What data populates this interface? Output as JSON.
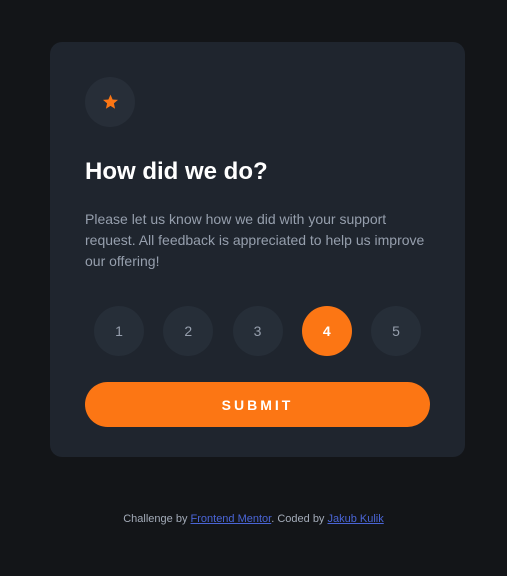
{
  "card": {
    "icon": "star-icon",
    "title": "How did we do?",
    "description": "Please let us know how we did with your support request. All feedback is appreciated to help us improve our offering!",
    "ratings": [
      "1",
      "2",
      "3",
      "4",
      "5"
    ],
    "selected_rating": "4",
    "submit_label": "SUBMIT"
  },
  "footer": {
    "prefix": "Challenge by ",
    "link1": "Frontend Mentor",
    "middle": ". Coded by ",
    "link2": "Jakub Kulik"
  },
  "colors": {
    "accent": "#fc7614",
    "card_bg": "#1f252e",
    "page_bg": "#131518",
    "link": "#4a65d6"
  }
}
